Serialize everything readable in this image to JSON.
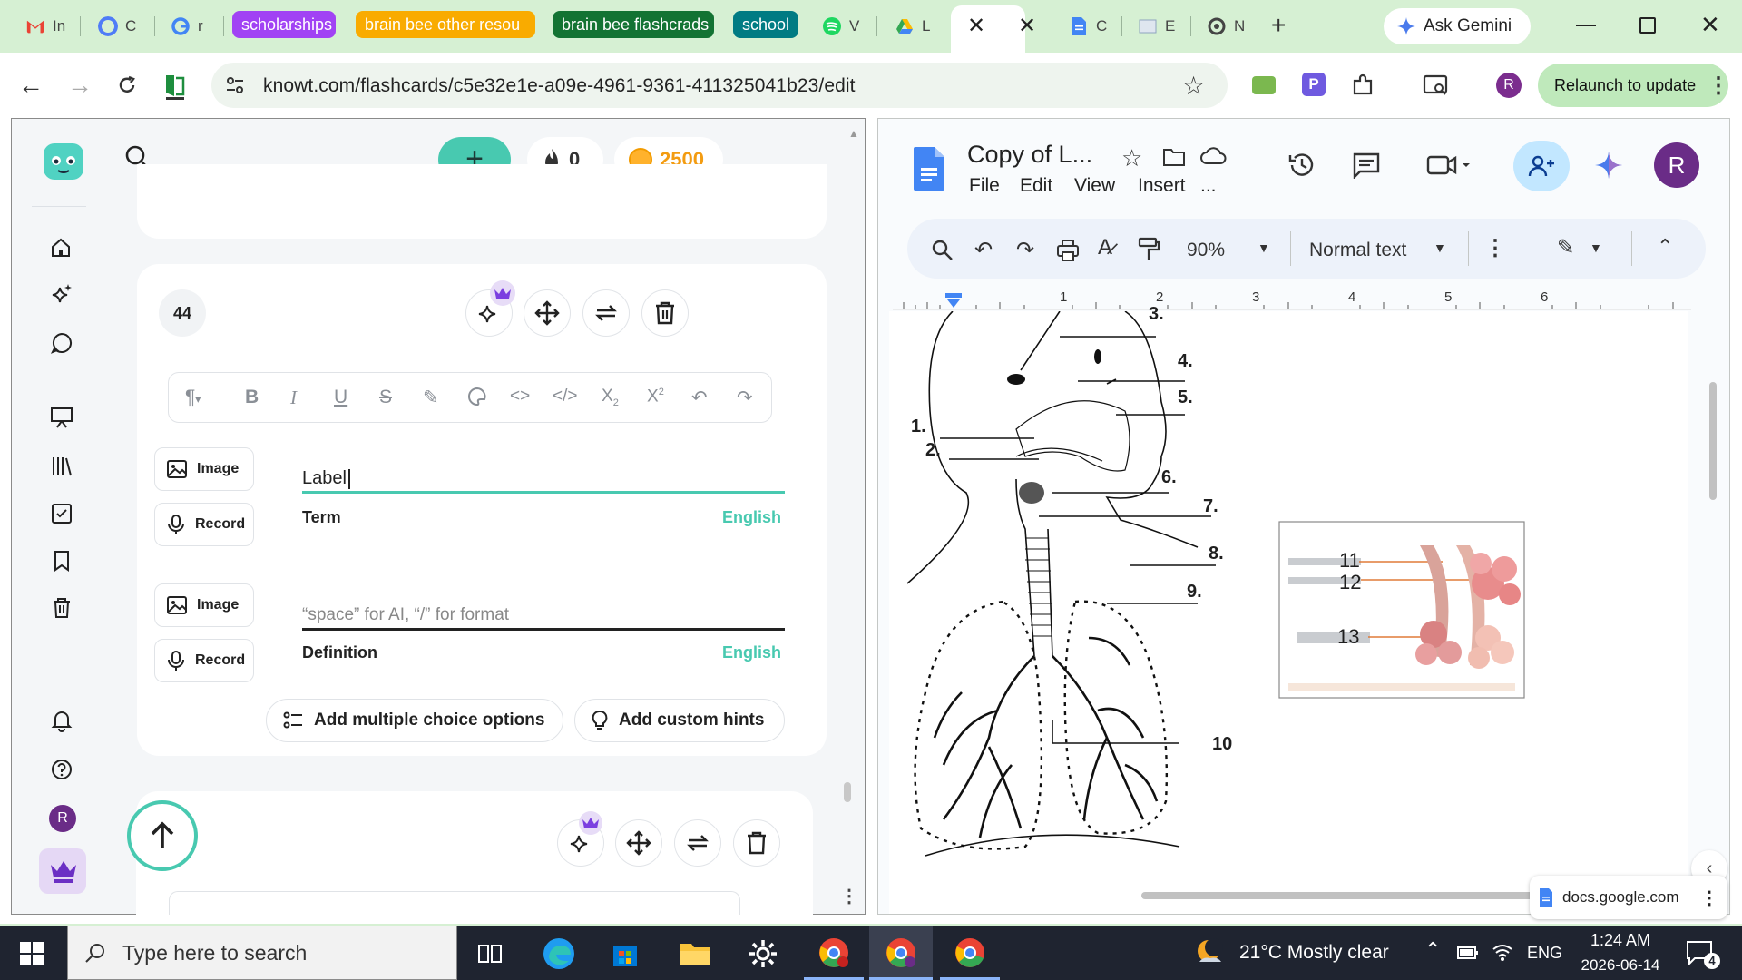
{
  "tabs": [
    {
      "label": "In",
      "favicon": "gmail-icon"
    },
    {
      "label": "C",
      "favicon": "copilot-icon"
    },
    {
      "label": "r",
      "favicon": "google-icon"
    }
  ],
  "tab_groups": [
    {
      "label": "scholarships",
      "color": "#a142f4"
    },
    {
      "label": "brain bee other resou",
      "color": "#f9ab00"
    },
    {
      "label": "brain bee flashcrads",
      "color": "#137333"
    },
    {
      "label": "school",
      "color": "#007b83"
    }
  ],
  "more_tabs": [
    {
      "label": "V",
      "favicon": "spotify-icon"
    },
    {
      "label": "L",
      "favicon": "drive-icon"
    },
    {
      "label": "C",
      "favicon": "docs-icon"
    },
    {
      "label": "E",
      "favicon": "image-icon"
    },
    {
      "label": "N",
      "favicon": "openai-icon"
    }
  ],
  "ask_gemini": "Ask Gemini",
  "url": "knowt.com/flashcards/c5e32e1e-a09e-4961-9361-411325041b23/edit",
  "relaunch": "Relaunch to update",
  "profile_initial": "R",
  "knowt": {
    "streak": "0",
    "coins": "2500",
    "card_number": "44",
    "toolbar_icons": [
      "paragraph-icon",
      "bold-icon",
      "italic-icon",
      "underline-icon",
      "strikethrough-icon",
      "highlight-icon",
      "palette-icon",
      "code-icon",
      "code-block-icon",
      "subscript-icon",
      "superscript-icon",
      "undo-icon",
      "redo-icon"
    ],
    "image_label": "Image",
    "record_label": "Record",
    "term_value": "Label",
    "term_label": "Term",
    "language": "English",
    "definition_placeholder": "“space” for AI, “/” for format",
    "definition_label": "Definition",
    "add_mc": "Add multiple choice options",
    "add_hints": "Add custom hints",
    "nav_initial": "R"
  },
  "docs": {
    "title": "Copy of L...",
    "menus": [
      "File",
      "Edit",
      "View",
      "Insert",
      "..."
    ],
    "zoom": "90%",
    "style": "Normal text",
    "ruler": [
      "1",
      "2",
      "3",
      "4",
      "5",
      "6"
    ],
    "labels": [
      "1.",
      "2.",
      "3.",
      "4.",
      "5.",
      "6.",
      "7.",
      "8.",
      "9.",
      "10",
      "11",
      "12",
      "13"
    ],
    "avatar": "R",
    "site": "docs.google.com"
  },
  "taskbar": {
    "search_placeholder": "Type here to search",
    "weather": "21°C  Mostly clear",
    "lang": "ENG",
    "time": "1:24 AM",
    "date": "2026-06-14",
    "notifications": "4"
  }
}
